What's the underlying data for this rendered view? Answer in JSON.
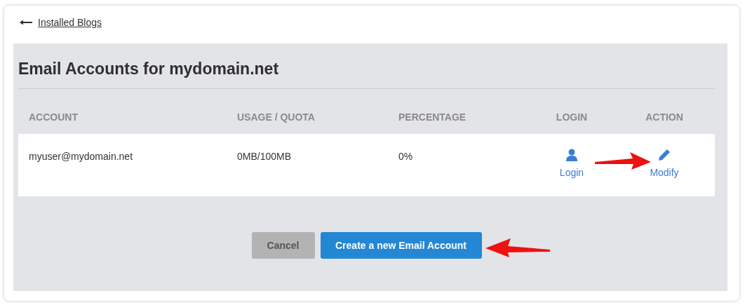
{
  "back_link": {
    "label": "Installed Blogs"
  },
  "title": "Email Accounts for mydomain.net",
  "table": {
    "columns": [
      "ACCOUNT",
      "USAGE / QUOTA",
      "PERCENTAGE",
      "LOGIN",
      "ACTION"
    ],
    "rows": [
      {
        "account": "myuser@mydomain.net",
        "usage_quota": "0MB/100MB",
        "percentage": "0%",
        "login": "Login",
        "action": "Modify"
      }
    ]
  },
  "buttons": [
    {
      "label": "Cancel",
      "kind": "secondary"
    },
    {
      "label": "Create a new Email Account",
      "kind": "primary"
    }
  ]
}
